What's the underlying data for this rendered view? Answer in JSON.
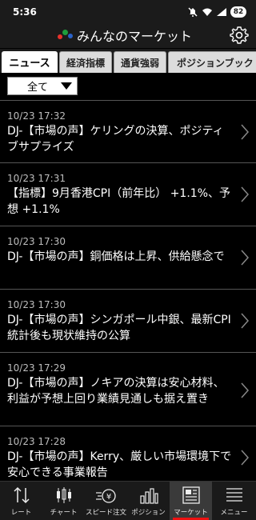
{
  "status": {
    "time": "5:36",
    "battery": "82"
  },
  "header": {
    "title": "みんなのマーケット",
    "logo_colors": [
      "#e8322c",
      "#1e9e3c",
      "#2a62c9"
    ]
  },
  "tabs": [
    {
      "label": "ニュース",
      "active": true
    },
    {
      "label": "経済指標",
      "active": false
    },
    {
      "label": "通貨強弱",
      "active": false
    },
    {
      "label": "ポジションブック",
      "active": false
    }
  ],
  "filter": {
    "selected": "全て"
  },
  "news": [
    {
      "date": "10/23 17:32",
      "headline": "DJ-【市場の声】ケリングの決算、ポジティブサプライズ"
    },
    {
      "date": "10/23 17:31",
      "headline": "【指標】9月香港CPI（前年比） +1.1%、予想 +1.1%"
    },
    {
      "date": "10/23 17:30",
      "headline": "DJ-【市場の声】銅価格は上昇、供給懸念で"
    },
    {
      "date": "10/23 17:30",
      "headline": "DJ-【市場の声】シンガポール中銀、最新CPI統計後も現状維持の公算"
    },
    {
      "date": "10/23 17:29",
      "headline": "DJ-【市場の声】ノキアの決算は安心材料、利益が予想上回り業績見通しも据え置き"
    },
    {
      "date": "10/23 17:28",
      "headline": "DJ-【市場の声】Kerry、厳しい市場環境下で安心できる事業報告"
    }
  ],
  "bottom_nav": [
    {
      "label": "レート",
      "icon": "rate-arrows-icon"
    },
    {
      "label": "チャート",
      "icon": "candlestick-chart-icon"
    },
    {
      "label": "スピード注文",
      "icon": "speed-order-icon"
    },
    {
      "label": "ポジション",
      "icon": "position-bars-icon"
    },
    {
      "label": "マーケット",
      "icon": "market-news-icon",
      "active": true
    },
    {
      "label": "メニュー",
      "icon": "menu-icon"
    }
  ],
  "colors": {
    "active_indicator": "#e11111",
    "background": "#000000",
    "header_bg": "#1b1b1b"
  }
}
